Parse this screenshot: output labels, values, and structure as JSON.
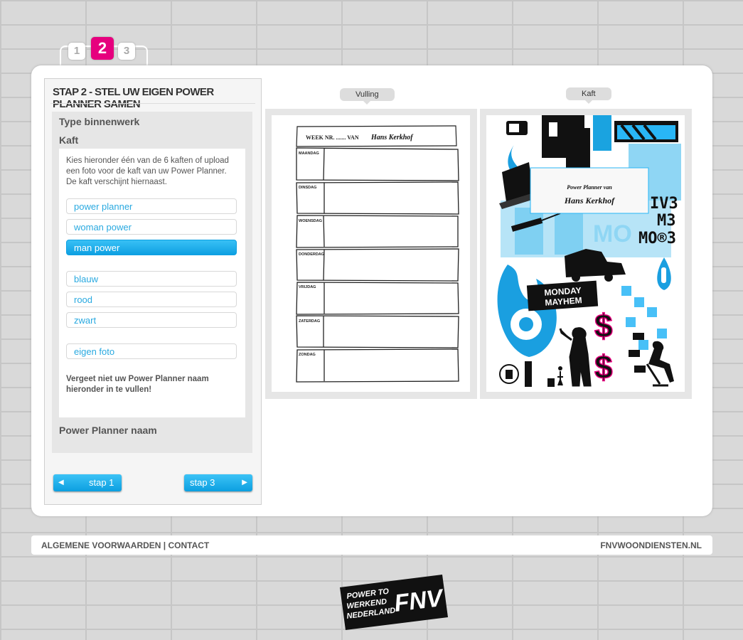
{
  "steps": [
    "1",
    "2",
    "3"
  ],
  "active_step": 2,
  "panel": {
    "title": "STAP 2 - STEL UW EIGEN POWER PLANNER SAMEN",
    "section_type": "Type binnenwerk",
    "section_kaft": "Kaft",
    "intro": "Kies hieronder één van de 6 kaften of upload een foto voor de kaft van uw Power Planner. De kaft verschijnt hiernaast.",
    "options": [
      "power planner",
      "woman power",
      "man power",
      "blauw",
      "rood",
      "zwart",
      "eigen foto"
    ],
    "selected_option": "man power",
    "note": "Vergeet niet uw Power Planner naam hieronder in te vullen!",
    "section_name": "Power Planner naam",
    "prev_label": "stap 1",
    "next_label": "stap 3"
  },
  "preview": {
    "vulling_label": "Vulling",
    "kaft_label": "Kaft",
    "week_label": "WEEK NR. ....... VAN",
    "owner_name": "Hans Kerkhof",
    "days": [
      "MAANDAG",
      "DINSDAG",
      "WOENSDAG",
      "DONDERDAG",
      "VRIJDAG",
      "ZATERDAG",
      "ZONDAG"
    ],
    "cover_title": "Power Planner van",
    "cover_name": "Hans Kerkhof",
    "cover_badge_line1": "MONDAY",
    "cover_badge_line2": "MAYHEM",
    "cover_text_lines": [
      "IV3",
      "M3",
      "MO®3"
    ],
    "cover_text_left": "MO",
    "cover_dollar": "$"
  },
  "footer": {
    "left": "ALGEMENE VOORWAARDEN | CONTACT",
    "right": "FNVWOONDIENSTEN.NL"
  },
  "logo": {
    "text1": "POWER TO",
    "text2": "WERKEND",
    "text3": "NEDERLAND",
    "mark": "FNV"
  },
  "colors": {
    "accent_pink": "#e6007e",
    "accent_blue": "#0ea0e2"
  }
}
